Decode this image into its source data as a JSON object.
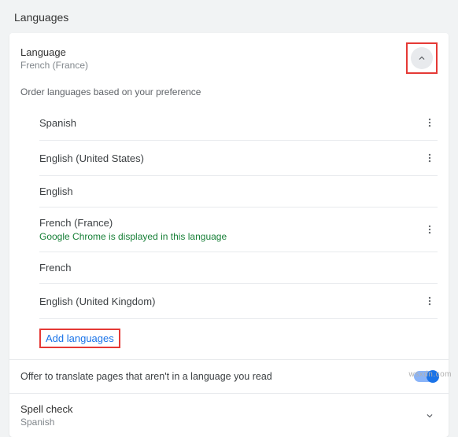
{
  "page": {
    "title": "Languages"
  },
  "language": {
    "label": "Language",
    "value": "French (France)"
  },
  "order_text": "Order languages based on your preference",
  "items": [
    {
      "name": "Spanish",
      "sub": "",
      "has_menu": true
    },
    {
      "name": "English (United States)",
      "sub": "",
      "has_menu": true
    },
    {
      "name": "English",
      "sub": "",
      "has_menu": false
    },
    {
      "name": "French (France)",
      "sub": "Google Chrome is displayed in this language",
      "has_menu": true
    },
    {
      "name": "French",
      "sub": "",
      "has_menu": false
    },
    {
      "name": "English (United Kingdom)",
      "sub": "",
      "has_menu": true
    }
  ],
  "add_languages": "Add languages",
  "translate": {
    "label": "Offer to translate pages that aren't in a language you read",
    "enabled": true
  },
  "spell": {
    "label": "Spell check",
    "value": "Spanish"
  },
  "watermark": "wsxdn.com"
}
